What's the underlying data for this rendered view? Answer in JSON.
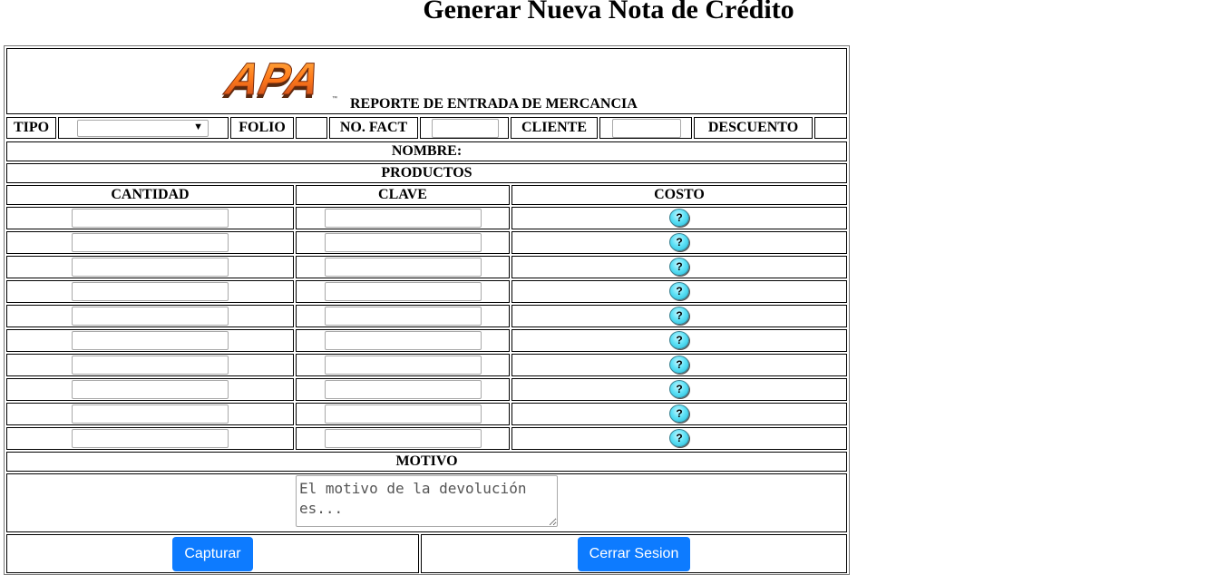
{
  "page": {
    "title": "Generar Nueva Nota de Crédito"
  },
  "header": {
    "logo_text": "APA",
    "report_title": "REPORTE DE ENTRADA DE MERCANCIA"
  },
  "fields": {
    "tipo_label": "TIPO",
    "tipo_value": "",
    "folio_label": "FOLIO",
    "folio_value": "",
    "nofact_label": "NO. FACT",
    "cliente_label": "CLIENTE",
    "descuento_label": "DESCUENTO",
    "descuento_value": ""
  },
  "nombre_label": "NOMBRE:",
  "productos": {
    "section_label": "PRODUCTOS",
    "columns": [
      "CANTIDAD",
      "CLAVE",
      "COSTO"
    ],
    "row_count": 10,
    "help_button_label": "?"
  },
  "motivo": {
    "label": "MOTIVO",
    "placeholder": "El motivo de la devolución es..."
  },
  "actions": {
    "capturar_label": "Capturar",
    "cerrar_label": "Cerrar Sesion"
  },
  "colors": {
    "accent": "#0d7bff",
    "help_button": "#5fe2f7"
  }
}
